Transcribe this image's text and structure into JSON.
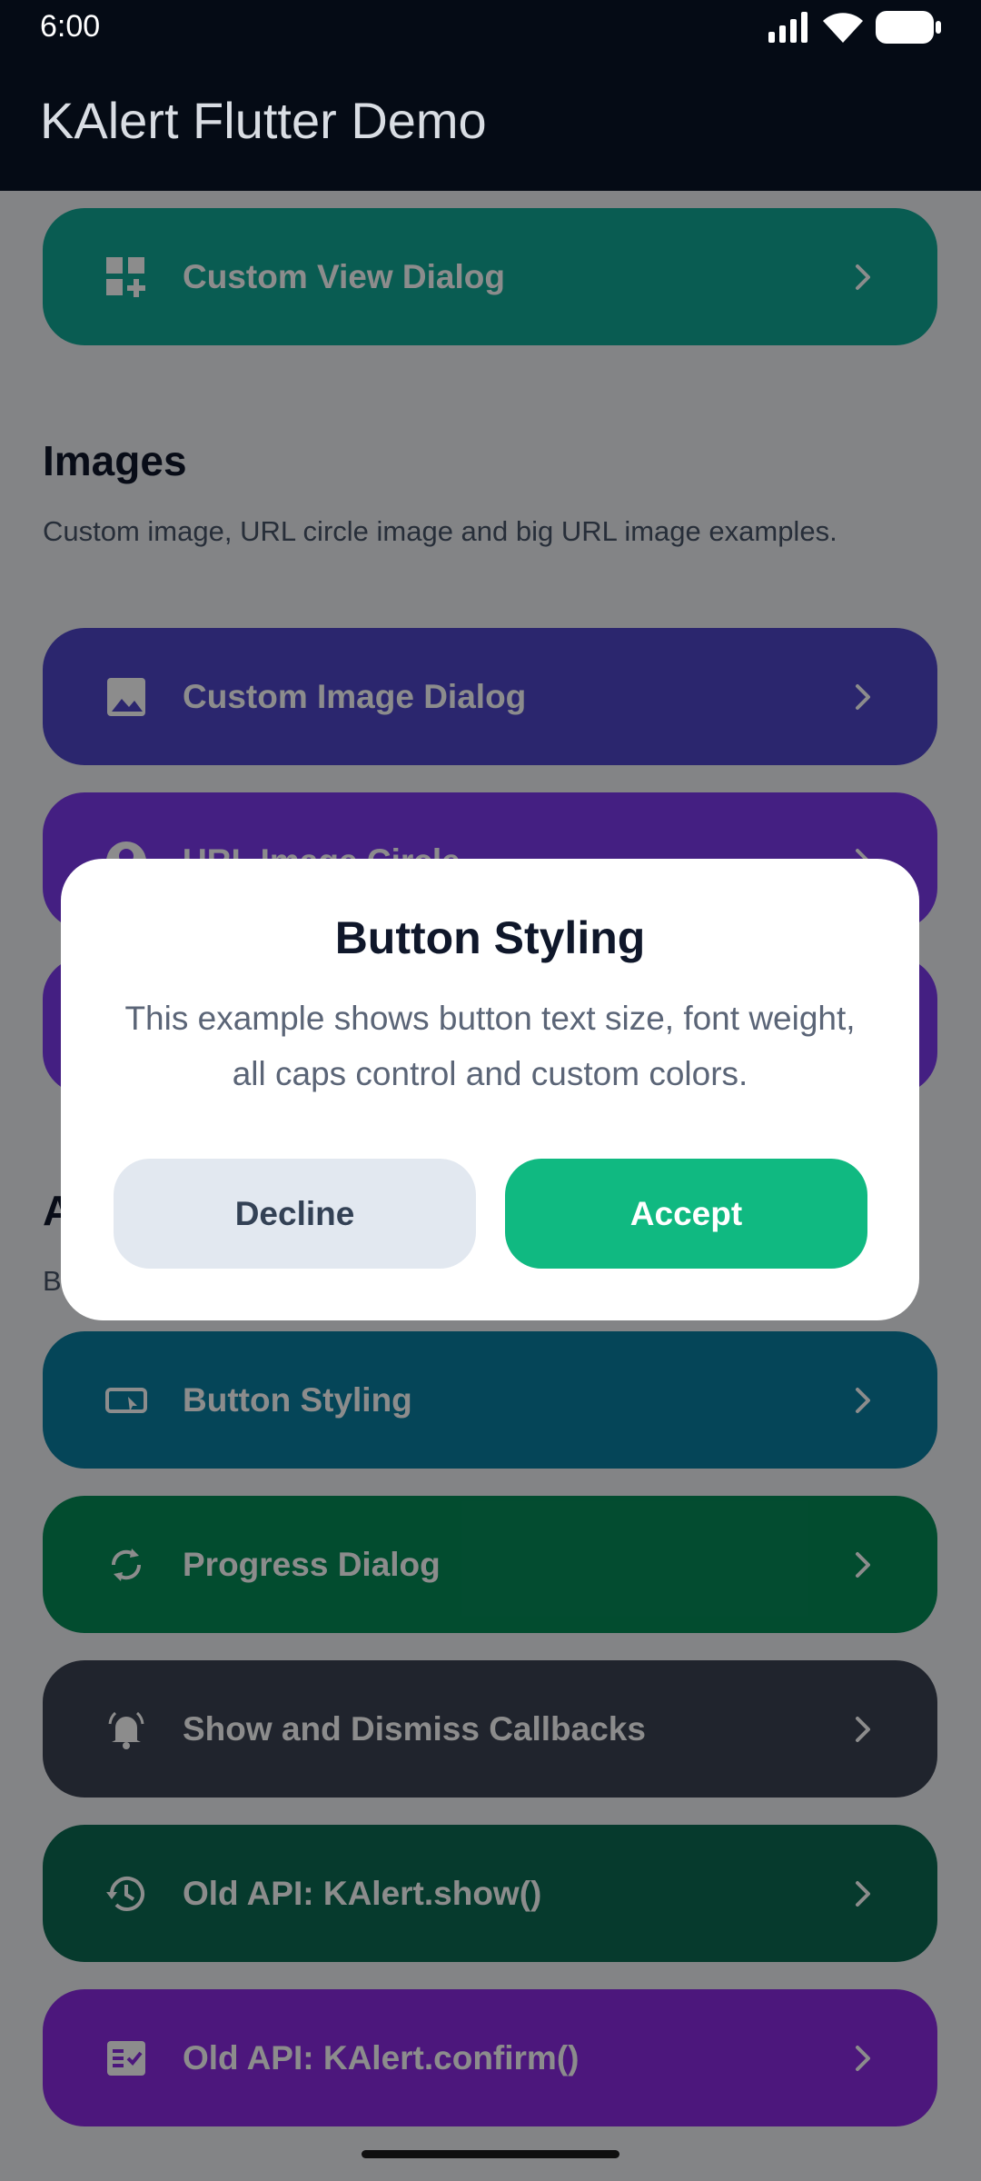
{
  "status_bar": {
    "time": "6:00"
  },
  "app_bar": {
    "title": "KAlert Flutter Demo"
  },
  "sections": {
    "images": {
      "title": "Images",
      "description": "Custom image, URL circle image and big URL image examples."
    },
    "advanced": {
      "title_visible": "A",
      "description_visible": "B"
    }
  },
  "buttons": {
    "custom_view": {
      "label": "Custom View Dialog",
      "icon": "dashboard-customize-icon",
      "color": "#11a895"
    },
    "custom_image": {
      "label": "Custom Image Dialog",
      "icon": "image-icon",
      "color": "#4f46c8"
    },
    "url_image_circle": {
      "label": "URL Image Circle",
      "icon": "account-circle-icon",
      "color": "#7c3aed"
    },
    "button_styling": {
      "label": "Button Styling",
      "icon": "smart-button-icon",
      "color": "#0a7ea0"
    },
    "progress_dialog": {
      "label": "Progress Dialog",
      "icon": "sync-icon",
      "color": "#058a57"
    },
    "callbacks": {
      "label": "Show and Dismiss Callbacks",
      "icon": "notifications-active-icon",
      "color": "#3b4252"
    },
    "old_show": {
      "label": "Old API: KAlert.show()",
      "icon": "history-icon",
      "color": "#0b6b52"
    },
    "old_confirm": {
      "label": "Old API: KAlert.confirm()",
      "icon": "fact-check-icon",
      "color": "#8a2be2"
    }
  },
  "dialog": {
    "title": "Button Styling",
    "message": "This example shows button text size, font weight, all caps control and custom colors.",
    "decline_label": "Decline",
    "accept_label": "Accept",
    "accept_color": "#10b981",
    "decline_color": "#e2e8f0"
  }
}
